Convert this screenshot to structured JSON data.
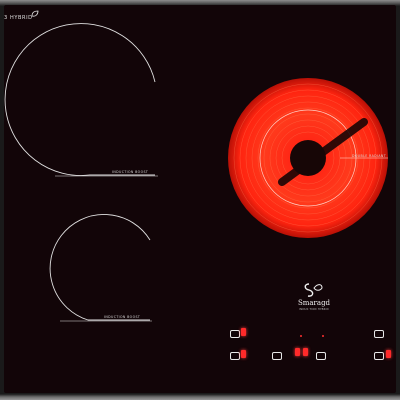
{
  "brand": {
    "hybrid_label": "3 HYBRID",
    "logo_name": "Smaragd",
    "logo_sub": "INDUK TION HYBRID"
  },
  "zones": [
    {
      "id": "rear-left",
      "type": "induction",
      "label": "INDUCTION BOOST"
    },
    {
      "id": "front-left",
      "type": "induction",
      "label": "INDUCTION BOOST"
    },
    {
      "id": "right",
      "type": "radiant",
      "label": "DOUBLE RADIANT"
    }
  ],
  "colors": {
    "glass": "#120508",
    "heat_hot": "#ff2a10",
    "heat_center": "#170606",
    "ring_line": "#e0e0e0",
    "display_red": "#ff2a2a"
  },
  "controls": [
    {
      "id": "zone1-display",
      "icon": "zone-indicator-icon"
    },
    {
      "id": "zone2-display",
      "icon": "zone-indicator-icon"
    },
    {
      "id": "center-display",
      "icon": "power-level-icon"
    },
    {
      "id": "timer-display",
      "icon": "timer-icon"
    },
    {
      "id": "zone3-display",
      "icon": "zone-indicator-icon"
    }
  ]
}
